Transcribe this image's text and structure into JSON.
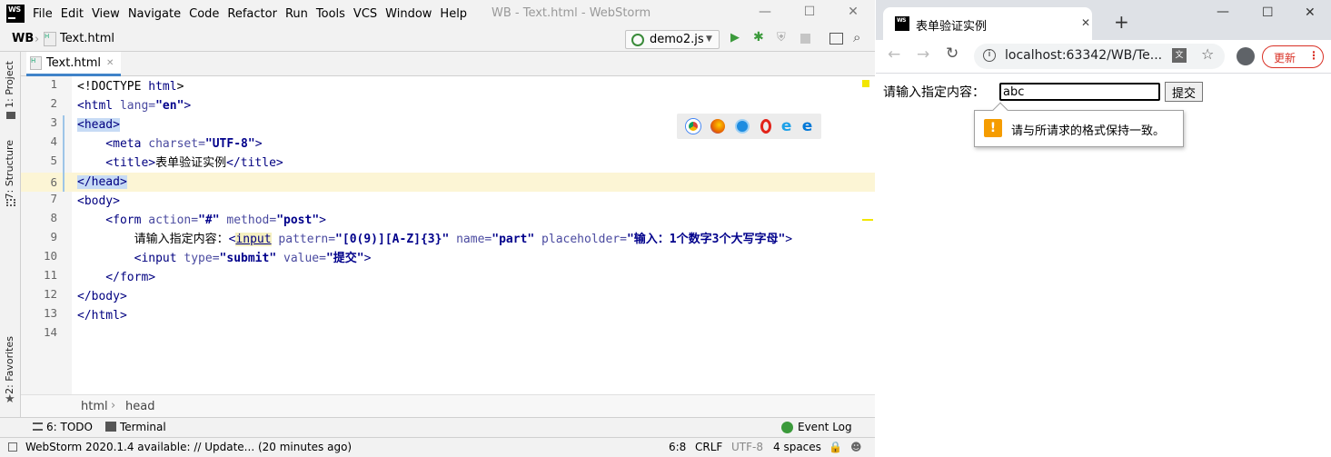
{
  "ide": {
    "window_title": "WB - Text.html - WebStorm",
    "menu": [
      "File",
      "Edit",
      "View",
      "Navigate",
      "Code",
      "Refactor",
      "Run",
      "Tools",
      "VCS",
      "Window",
      "Help"
    ],
    "project_label": "WB",
    "breadcrumb_file": "Text.html",
    "run_config": "demo2.js",
    "tab_label": "Text.html",
    "side_tabs": [
      "1: Project",
      "7: Structure",
      "2: Favorites"
    ],
    "line_numbers": [
      "1",
      "2",
      "3",
      "4",
      "5",
      "6",
      "7",
      "8",
      "9",
      "10",
      "11",
      "12",
      "13",
      "14"
    ],
    "code": {
      "l1a": "<!DOCTYPE ",
      "l1b": "html",
      "l1c": ">",
      "l2a": "<html ",
      "l2b": "lang=",
      "l2c": "\"en\"",
      "l2d": ">",
      "l3": "<head>",
      "l4a": "    <meta ",
      "l4b": "charset=",
      "l4c": "\"UTF-8\"",
      "l4d": ">",
      "l5a": "    <title>",
      "l5b": "表单验证实例",
      "l5c": "</title>",
      "l6": "</head>",
      "l7": "<body>",
      "l8a": "    <form ",
      "l8b": "action=",
      "l8c": "\"#\"",
      "l8d": " method=",
      "l8e": "\"post\"",
      "l8f": ">",
      "l9a": "        请输入指定内容：",
      "l9b": "<",
      "l9c": "input",
      "l9d": " pattern=",
      "l9e": "\"[0(9)][A-Z]{3}\"",
      "l9f": " name=",
      "l9g": "\"part\"",
      "l9h": " placeholder=",
      "l9i": "\"输入：1个数字3个大写字母\"",
      "l9j": ">",
      "l10a": "        <input ",
      "l10b": "type=",
      "l10c": "\"submit\"",
      "l10d": " value=",
      "l10e": "\"提交\"",
      "l10f": ">",
      "l11": "    </form>",
      "l12": "</body>",
      "l13": "</html>"
    },
    "breadcrumb_path": [
      "html",
      "head"
    ],
    "bottom_tabs": {
      "todo": "6: TODO",
      "terminal": "Terminal",
      "event_log": "Event Log"
    },
    "status": {
      "message": "WebStorm 2020.1.4 available: // Update... (20 minutes ago)",
      "position": "6:8",
      "line_sep": "CRLF",
      "encoding": "UTF-8",
      "indent": "4 spaces"
    }
  },
  "browser": {
    "tab_title": "表单验证实例",
    "url": "localhost:63342/WB/Te...",
    "update_label": "更新",
    "form": {
      "label": "请输入指定内容：",
      "input_value": "abc",
      "submit_label": "提交"
    },
    "validation_message": "请与所请求的格式保持一致。"
  }
}
